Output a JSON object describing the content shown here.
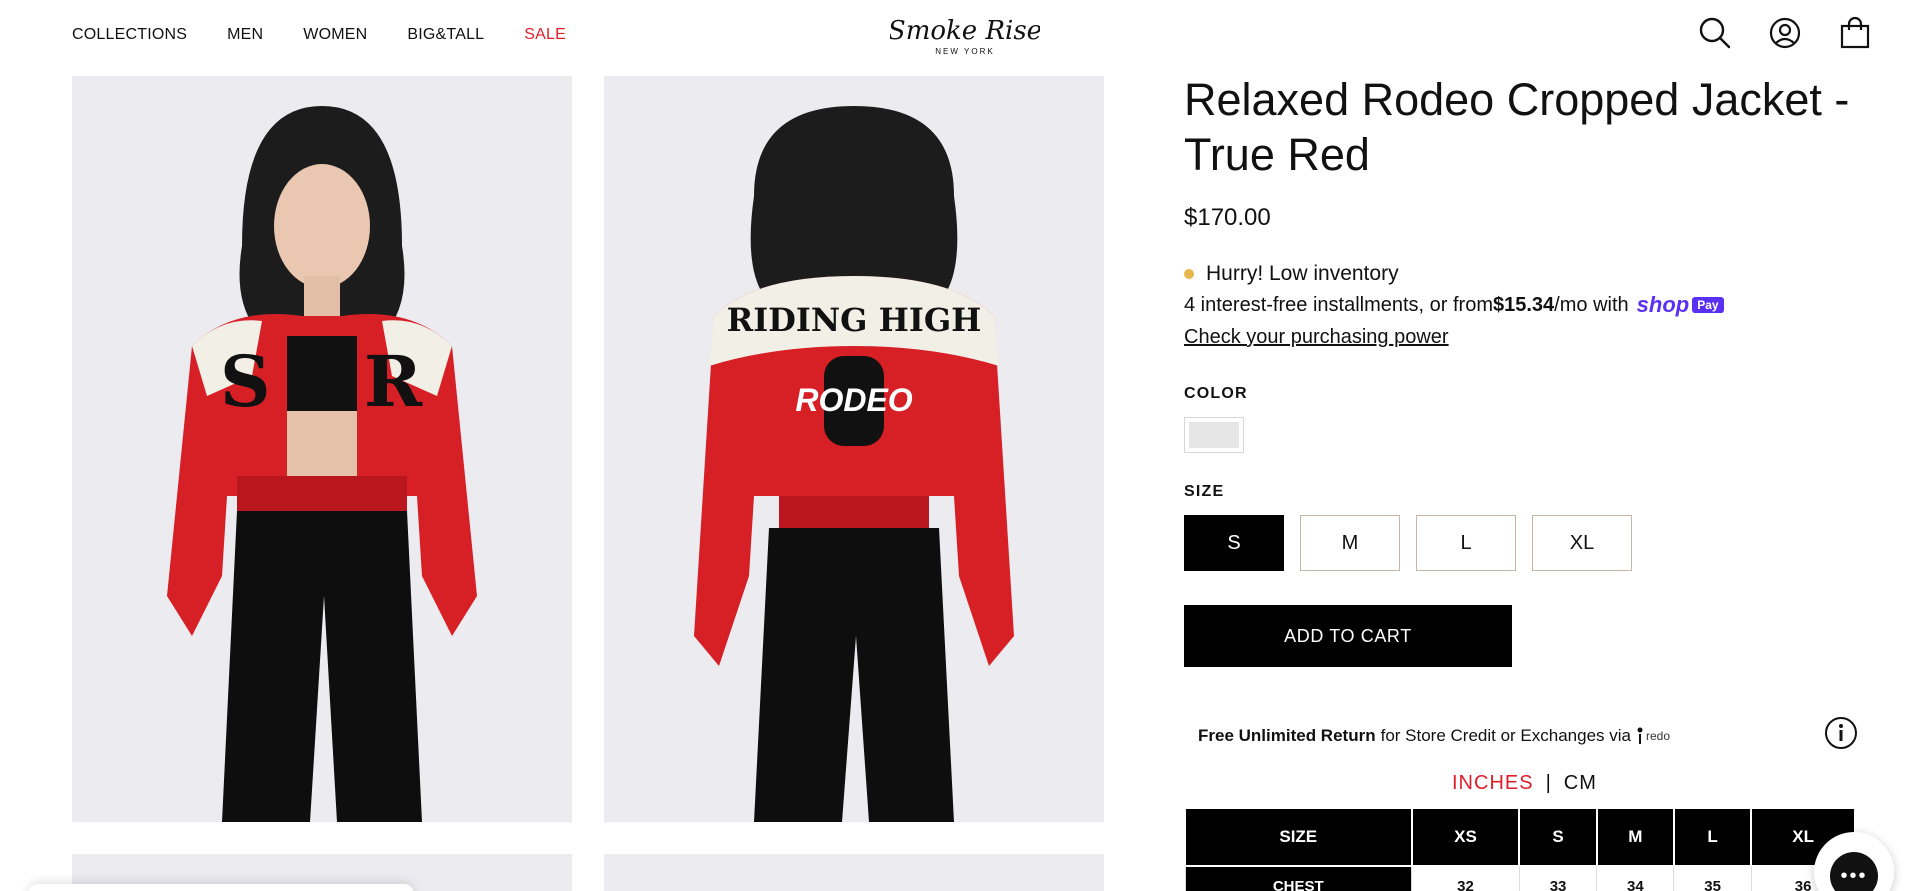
{
  "nav": {
    "items": [
      {
        "label": "COLLECTIONS"
      },
      {
        "label": "MEN"
      },
      {
        "label": "WOMEN"
      },
      {
        "label": "BIG&TALL"
      },
      {
        "label": "SALE"
      }
    ]
  },
  "logo": {
    "brand": "Smoke Rise",
    "sub": "NEW YORK"
  },
  "header_icons": [
    "search-icon",
    "account-icon",
    "cart-bag-icon"
  ],
  "product": {
    "title": "Relaxed Rodeo Cropped Jacket - True Red",
    "price": "$170.00",
    "stock_text": "Hurry! Low inventory",
    "stock_dot_color": "#e8b64a",
    "installments_prefix": "4 interest-free installments, or from ",
    "installments_amount": "$15.34",
    "installments_suffix": "/mo with ",
    "shop_pay_word": "shop",
    "shop_pay_badge": "Pay",
    "check_power": "Check your purchasing power",
    "color_label": "COLOR",
    "size_label": "SIZE",
    "sizes": [
      "S",
      "M",
      "L",
      "XL"
    ],
    "selected_size": "S",
    "add_to_cart": "ADD TO CART"
  },
  "returns": {
    "bold": "Free Unlimited Return",
    "rest": "for Store Credit or Exchanges via",
    "brand": "redo"
  },
  "units": {
    "inches": "INCHES",
    "separator": "|",
    "cm": "CM"
  },
  "size_table": {
    "headers": [
      "SIZE",
      "XS",
      "S",
      "M",
      "L",
      "XL"
    ],
    "row_label": "CHEST",
    "row_values": [
      "32",
      "33",
      "34",
      "35",
      "36"
    ]
  },
  "colors": {
    "accent_red": "#e01e2b",
    "shop_pay": "#5a31f4"
  }
}
